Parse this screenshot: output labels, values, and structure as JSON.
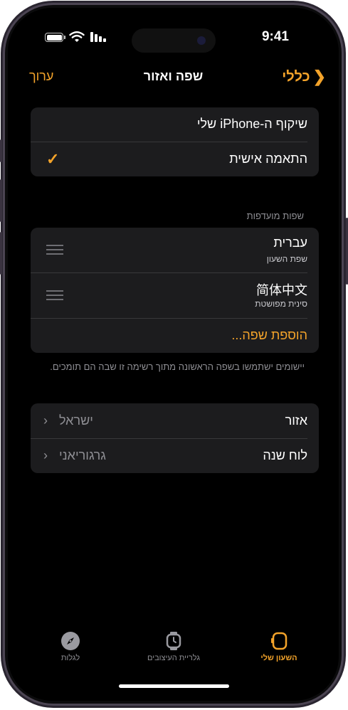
{
  "status_bar": {
    "time": "9:41",
    "icons": [
      "battery-icon",
      "wifi-icon",
      "signal-icon"
    ]
  },
  "nav": {
    "title": "שפה ואזור",
    "back_label": "כללי",
    "edit_label": "ערוך"
  },
  "mode_options": [
    {
      "label": "שיקוף ה-iPhone שלי",
      "checked": false
    },
    {
      "label": "התאמה אישית",
      "checked": true
    }
  ],
  "preferred_languages": {
    "header": "שפות מועדפות",
    "languages": [
      {
        "name": "עברית",
        "subtitle": "שפת השעון"
      },
      {
        "name": "简体中文",
        "subtitle": "סינית מפושטת"
      }
    ],
    "add_label": "הוספת שפה...",
    "footer": "יישומים ישתמשו בשפה הראשונה מתוך רשימה זו שבה הם תומכים."
  },
  "region_settings": [
    {
      "label": "אזור",
      "value": "ישראל"
    },
    {
      "label": "לוח שנה",
      "value": "גרגוריאני"
    }
  ],
  "tabbar": {
    "tabs": [
      {
        "label": "לגלות",
        "icon": "compass-icon",
        "active": false
      },
      {
        "label": "גלריית העיצובים",
        "icon": "watch-icon",
        "active": false
      },
      {
        "label": "השעון שלי",
        "icon": "watch-side-icon",
        "active": true
      }
    ]
  },
  "colors": {
    "accent": "#f3a32a",
    "background": "#000000",
    "cell": "#1c1c1e",
    "secondary_text": "#8e8e93"
  }
}
